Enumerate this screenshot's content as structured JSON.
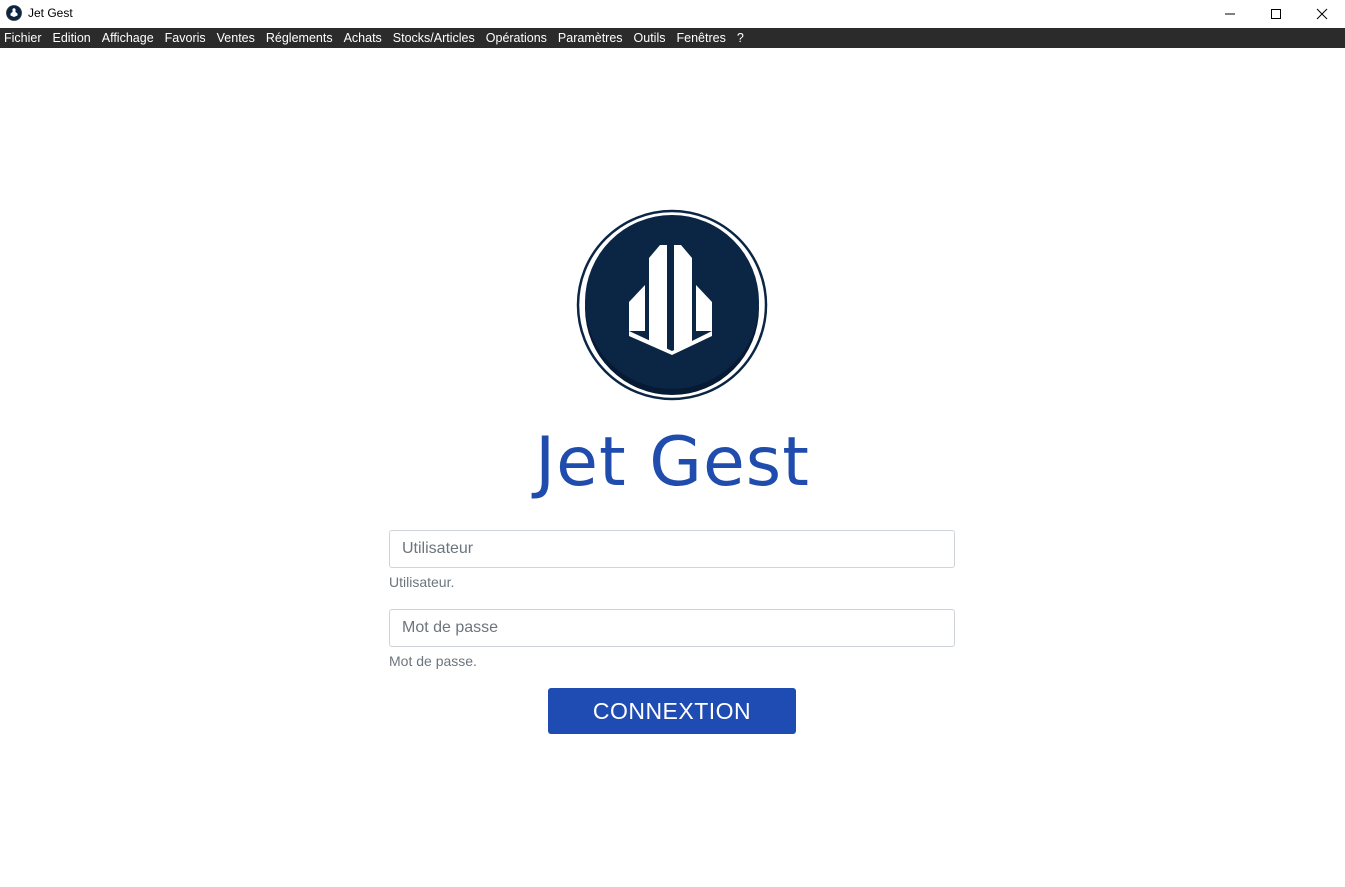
{
  "window": {
    "title": "Jet Gest",
    "controls": [
      "minimize-icon",
      "maximize-icon",
      "close-icon"
    ]
  },
  "menubar": {
    "items": [
      "Fichier",
      "Edition",
      "Affichage",
      "Favoris",
      "Ventes",
      "Réglements",
      "Achats",
      "Stocks/Articles",
      "Opérations",
      "Paramètres",
      "Outils",
      "Fenêtres",
      "?"
    ]
  },
  "login": {
    "app_name": "Jet Gest",
    "logo_icon": "jet-gest-logo-icon",
    "username": {
      "placeholder": "Utilisateur",
      "value": "",
      "help": "Utilisateur."
    },
    "password": {
      "placeholder": "Mot de passe",
      "value": "",
      "help": "Mot de passe."
    },
    "submit_label": "CONNEXTION"
  },
  "colors": {
    "brand_blue": "#1f4cad",
    "button_blue": "#1f4cb3",
    "logo_navy": "#0b2545",
    "menubar_bg": "#2b2b2b"
  }
}
